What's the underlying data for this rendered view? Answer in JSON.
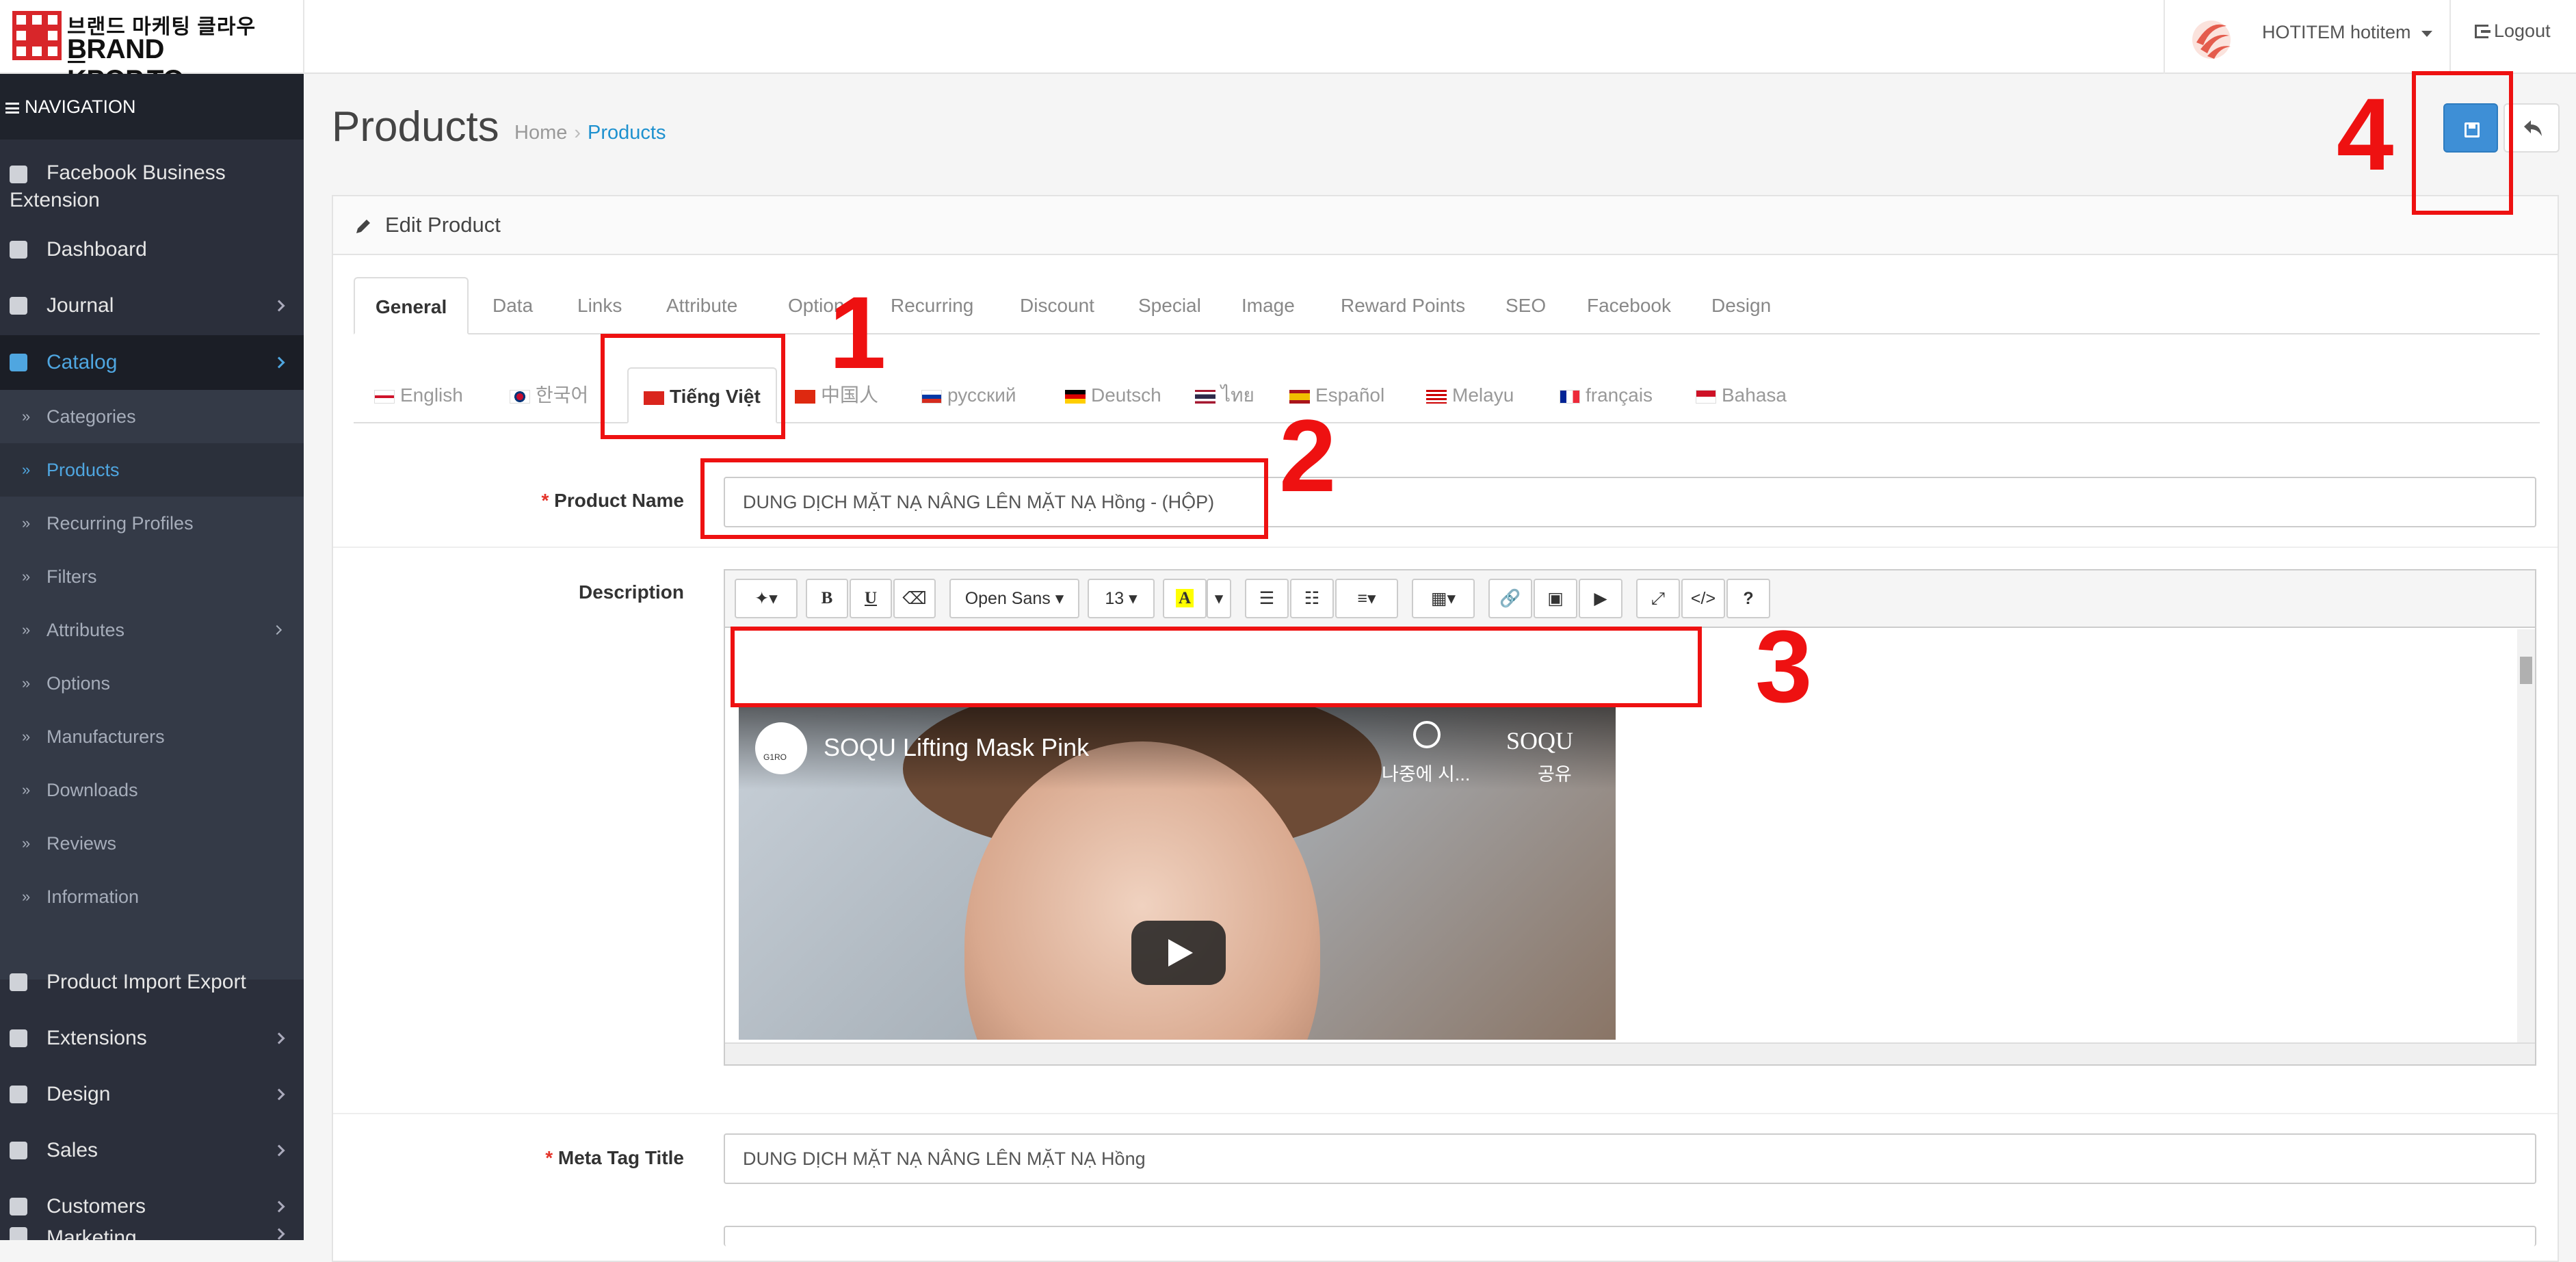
{
  "header": {
    "logo_korean": "브랜드 마케팅 클라우드",
    "logo_brand": "BRAND KPOP.TO",
    "user_name": "HOTITEM hotitem",
    "logout": "Logout"
  },
  "sidebar": {
    "title": "NAVIGATION",
    "items": [
      {
        "label": "Facebook Business",
        "label2": "Extension",
        "icon": "facebook-icon"
      },
      {
        "label": "Dashboard",
        "icon": "dashboard-icon"
      },
      {
        "label": "Journal",
        "icon": "journal-icon"
      },
      {
        "label": "Catalog",
        "icon": "tag-icon"
      },
      {
        "label": "Product Import Export",
        "icon": "import-export-icon"
      },
      {
        "label": "Extensions",
        "icon": "puzzle-icon"
      },
      {
        "label": "Design",
        "icon": "monitor-icon"
      },
      {
        "label": "Sales",
        "icon": "cart-icon"
      },
      {
        "label": "Customers",
        "icon": "user-icon"
      },
      {
        "label": "Marketing",
        "icon": "share-icon"
      }
    ],
    "catalog_sub": [
      {
        "label": "Categories"
      },
      {
        "label": "Products"
      },
      {
        "label": "Recurring Profiles"
      },
      {
        "label": "Filters"
      },
      {
        "label": "Attributes"
      },
      {
        "label": "Options"
      },
      {
        "label": "Manufacturers"
      },
      {
        "label": "Downloads"
      },
      {
        "label": "Reviews"
      },
      {
        "label": "Information"
      }
    ]
  },
  "page": {
    "title": "Products",
    "breadcrumb": [
      "Home",
      "Products"
    ],
    "panel_title": "Edit Product"
  },
  "tabs": [
    "General",
    "Data",
    "Links",
    "Attribute",
    "Option",
    "Recurring",
    "Discount",
    "Special",
    "Image",
    "Reward Points",
    "SEO",
    "Facebook",
    "Design"
  ],
  "languages": [
    "English",
    "한국어",
    "Tiếng Việt",
    "中国人",
    "русский",
    "Deutsch",
    "ไทย",
    "Español",
    "Melayu",
    "français",
    "Bahasa"
  ],
  "form": {
    "product_name_label": "Product Name",
    "product_name_value": "DUNG DỊCH MẶT NẠ NÂNG LÊN MẶT NẠ Hồng - (HỘP)",
    "description_label": "Description",
    "meta_title_label": "Meta Tag Title",
    "meta_title_value": "DUNG DỊCH MẶT NẠ NÂNG LÊN MẶT NẠ Hồng",
    "required_mark": "*"
  },
  "editor": {
    "font_family": "Open Sans",
    "font_size": "13"
  },
  "video": {
    "title": "SOQU Lifting Mask Pink",
    "watch_later": "나중에 시...",
    "share": "공유",
    "logo": "SOQU",
    "channel": "G1RO"
  },
  "annotations": [
    "1",
    "2",
    "3",
    "4"
  ],
  "colors": {
    "accent": "#1e91cf",
    "sidebar": "#2b2f3b",
    "annotation": "#ee1111"
  }
}
